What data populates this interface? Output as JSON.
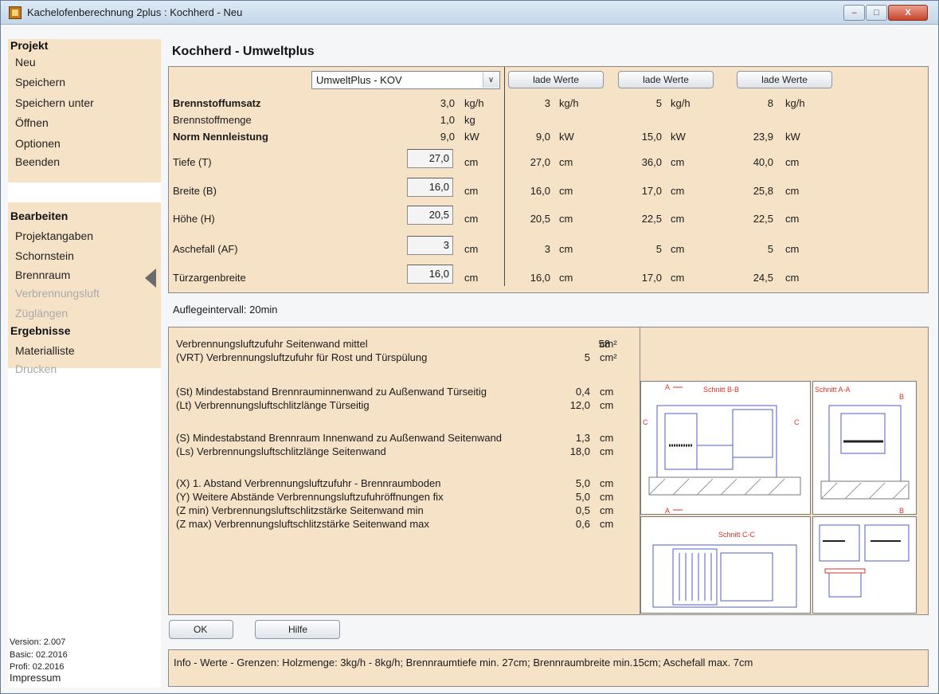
{
  "window": {
    "title": "Kachelofenberechnung 2plus : Kochherd - Neu",
    "controls": {
      "minimize": "–",
      "maximize": "□",
      "close": "X"
    }
  },
  "sidebar": {
    "projekt_header": "Projekt",
    "projekt_items": [
      "Neu",
      "Speichern",
      "Speichern unter",
      "Öffnen",
      "Optionen",
      "Beenden"
    ],
    "bearbeiten_header": "Bearbeiten",
    "bearbeiten_items": [
      "Projektangaben",
      "Schornstein",
      "Brennraum",
      "Verbrennungsluft",
      "Züglängen"
    ],
    "ergebnisse_header": "Ergebnisse",
    "ergebnisse_items": [
      "Materialliste",
      "Drucken"
    ],
    "version": "Version: 2.007",
    "basic": "Basic: 02.2016",
    "profi": "Profi: 02.2016",
    "impressum": "Impressum"
  },
  "main": {
    "title": "Kochherd - Umweltplus",
    "select_value": "UmweltPlus - KOV",
    "load_button": "lade Werte",
    "rows": [
      {
        "label": "Brennstoffumsatz",
        "bold": true,
        "value": "3,0",
        "unit": "kg/h",
        "c1": "3",
        "u1": "kg/h",
        "c2": "5",
        "u2": "kg/h",
        "c3": "8",
        "u3": "kg/h"
      },
      {
        "label": "Brennstoffmenge",
        "bold": false,
        "value": "1,0",
        "unit": "kg",
        "c1": "",
        "u1": "",
        "c2": "",
        "u2": "",
        "c3": "",
        "u3": ""
      },
      {
        "label": "Norm Nennleistung",
        "bold": true,
        "value": "9,0",
        "unit": "kW",
        "c1": "9,0",
        "u1": "kW",
        "c2": "15,0",
        "u2": "kW",
        "c3": "23,9",
        "u3": "kW"
      },
      {
        "label": "Tiefe (T)",
        "bold": false,
        "value": "27,0",
        "unit": "cm",
        "c1": "27,0",
        "u1": "cm",
        "c2": "36,0",
        "u2": "cm",
        "c3": "40,0",
        "u3": "cm"
      },
      {
        "label": "Breite (B)",
        "bold": false,
        "value": "16,0",
        "unit": "cm",
        "c1": "16,0",
        "u1": "cm",
        "c2": "17,0",
        "u2": "cm",
        "c3": "25,8",
        "u3": "cm"
      },
      {
        "label": "Höhe (H)",
        "bold": false,
        "value": "20,5",
        "unit": "cm",
        "c1": "20,5",
        "u1": "cm",
        "c2": "22,5",
        "u2": "cm",
        "c3": "22,5",
        "u3": "cm"
      },
      {
        "label": "Aschefall (AF)",
        "bold": false,
        "value": "3",
        "unit": "cm",
        "c1": "3",
        "u1": "cm",
        "c2": "5",
        "u2": "cm",
        "c3": "5",
        "u3": "cm"
      },
      {
        "label": "Türzargenbreite",
        "bold": false,
        "value": "16,0",
        "unit": "cm",
        "c1": "16,0",
        "u1": "cm",
        "c2": "17,0",
        "u2": "cm",
        "c3": "24,5",
        "u3": "cm"
      }
    ],
    "interval": "Auflegeintervall: 20min"
  },
  "results": [
    {
      "label": "Verbrennungsluftzufuhr  Seitenwand mittel",
      "value": "58",
      "unit": "cm²"
    },
    {
      "label": "(VRT) Verbrennungsluftzufuhr für Rost und Türspülung",
      "value": "5",
      "unit": "cm²"
    },
    {
      "label": "(St) Mindestabstand Brennrauminnenwand zu Außenwand Türseitig",
      "value": "0,4",
      "unit": "cm"
    },
    {
      "label": "(Lt) Verbrennungsluftschlitzlänge Türseitig",
      "value": "12,0",
      "unit": "cm"
    },
    {
      "label": "(S) Mindestabstand Brennraum Innenwand zu Außenwand Seitenwand",
      "value": "1,3",
      "unit": "cm"
    },
    {
      "label": "(Ls) Verbrennungsluftschlitzlänge Seitenwand",
      "value": "18,0",
      "unit": "cm"
    },
    {
      "label": "(X) 1. Abstand Verbrennungsluftzufuhr - Brennraumboden",
      "value": "5,0",
      "unit": "cm"
    },
    {
      "label": "(Y) Weitere Abstände Verbrennungsluftzufuhröffnungen fix",
      "value": "5,0",
      "unit": "cm"
    },
    {
      "label": "(Z min) Verbrennungsluftschlitzstärke Seitenwand min",
      "value": "0,5",
      "unit": "cm"
    },
    {
      "label": "(Z max) Verbrennungsluftschlitzstärke Seitenwand max",
      "value": "0,6",
      "unit": "cm"
    }
  ],
  "drawings": {
    "schnitt_bb": "Schnitt B-B",
    "schnitt_aa": "Schnitt A-A",
    "schnitt_cc": "Schnitt C-C",
    "label_a": "A",
    "label_b": "B",
    "label_c": "C"
  },
  "buttons": {
    "ok": "OK",
    "hilfe": "Hilfe"
  },
  "info": "Info - Werte - Grenzen:  Holzmenge: 3kg/h - 8kg/h; Brennraumtiefe min. 27cm; Brennraumbreite min.15cm; Aschefall max. 7cm",
  "colors": {
    "panel": "#f6e3c7",
    "border": "#8a8a8a",
    "drawing_red": "#d6332b",
    "drawing_blue": "#4d5fc0"
  }
}
